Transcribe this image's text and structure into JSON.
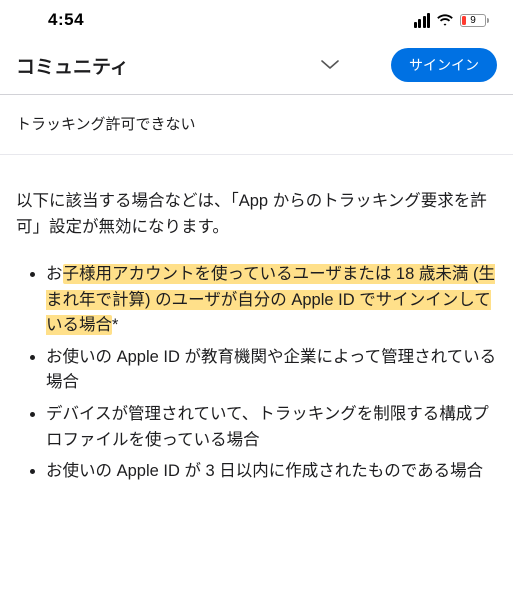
{
  "status": {
    "time": "4:54",
    "battery": "9"
  },
  "nav": {
    "title": "コミュニティ",
    "signin": "サインイン"
  },
  "subhead": "トラッキング許可できない",
  "intro": "以下に該当する場合などは、「App からのトラッキング要求を許可」設定が無効になります。",
  "bullets": {
    "b1_pre": "お",
    "b1_hl": "子様用アカウントを使っているユーザまたは 18 歳未満 (生まれ年で計算) のユーザが自分の Apple ID でサインインしている場合",
    "b1_post": "*",
    "b2": "お使いの Apple ID が教育機関や企業によって管理されている場合",
    "b3": "デバイスが管理されていて、トラッキングを制限する構成プロファイルを使っている場合",
    "b4": "お使いの Apple ID が 3 日以内に作成されたものである場合"
  }
}
